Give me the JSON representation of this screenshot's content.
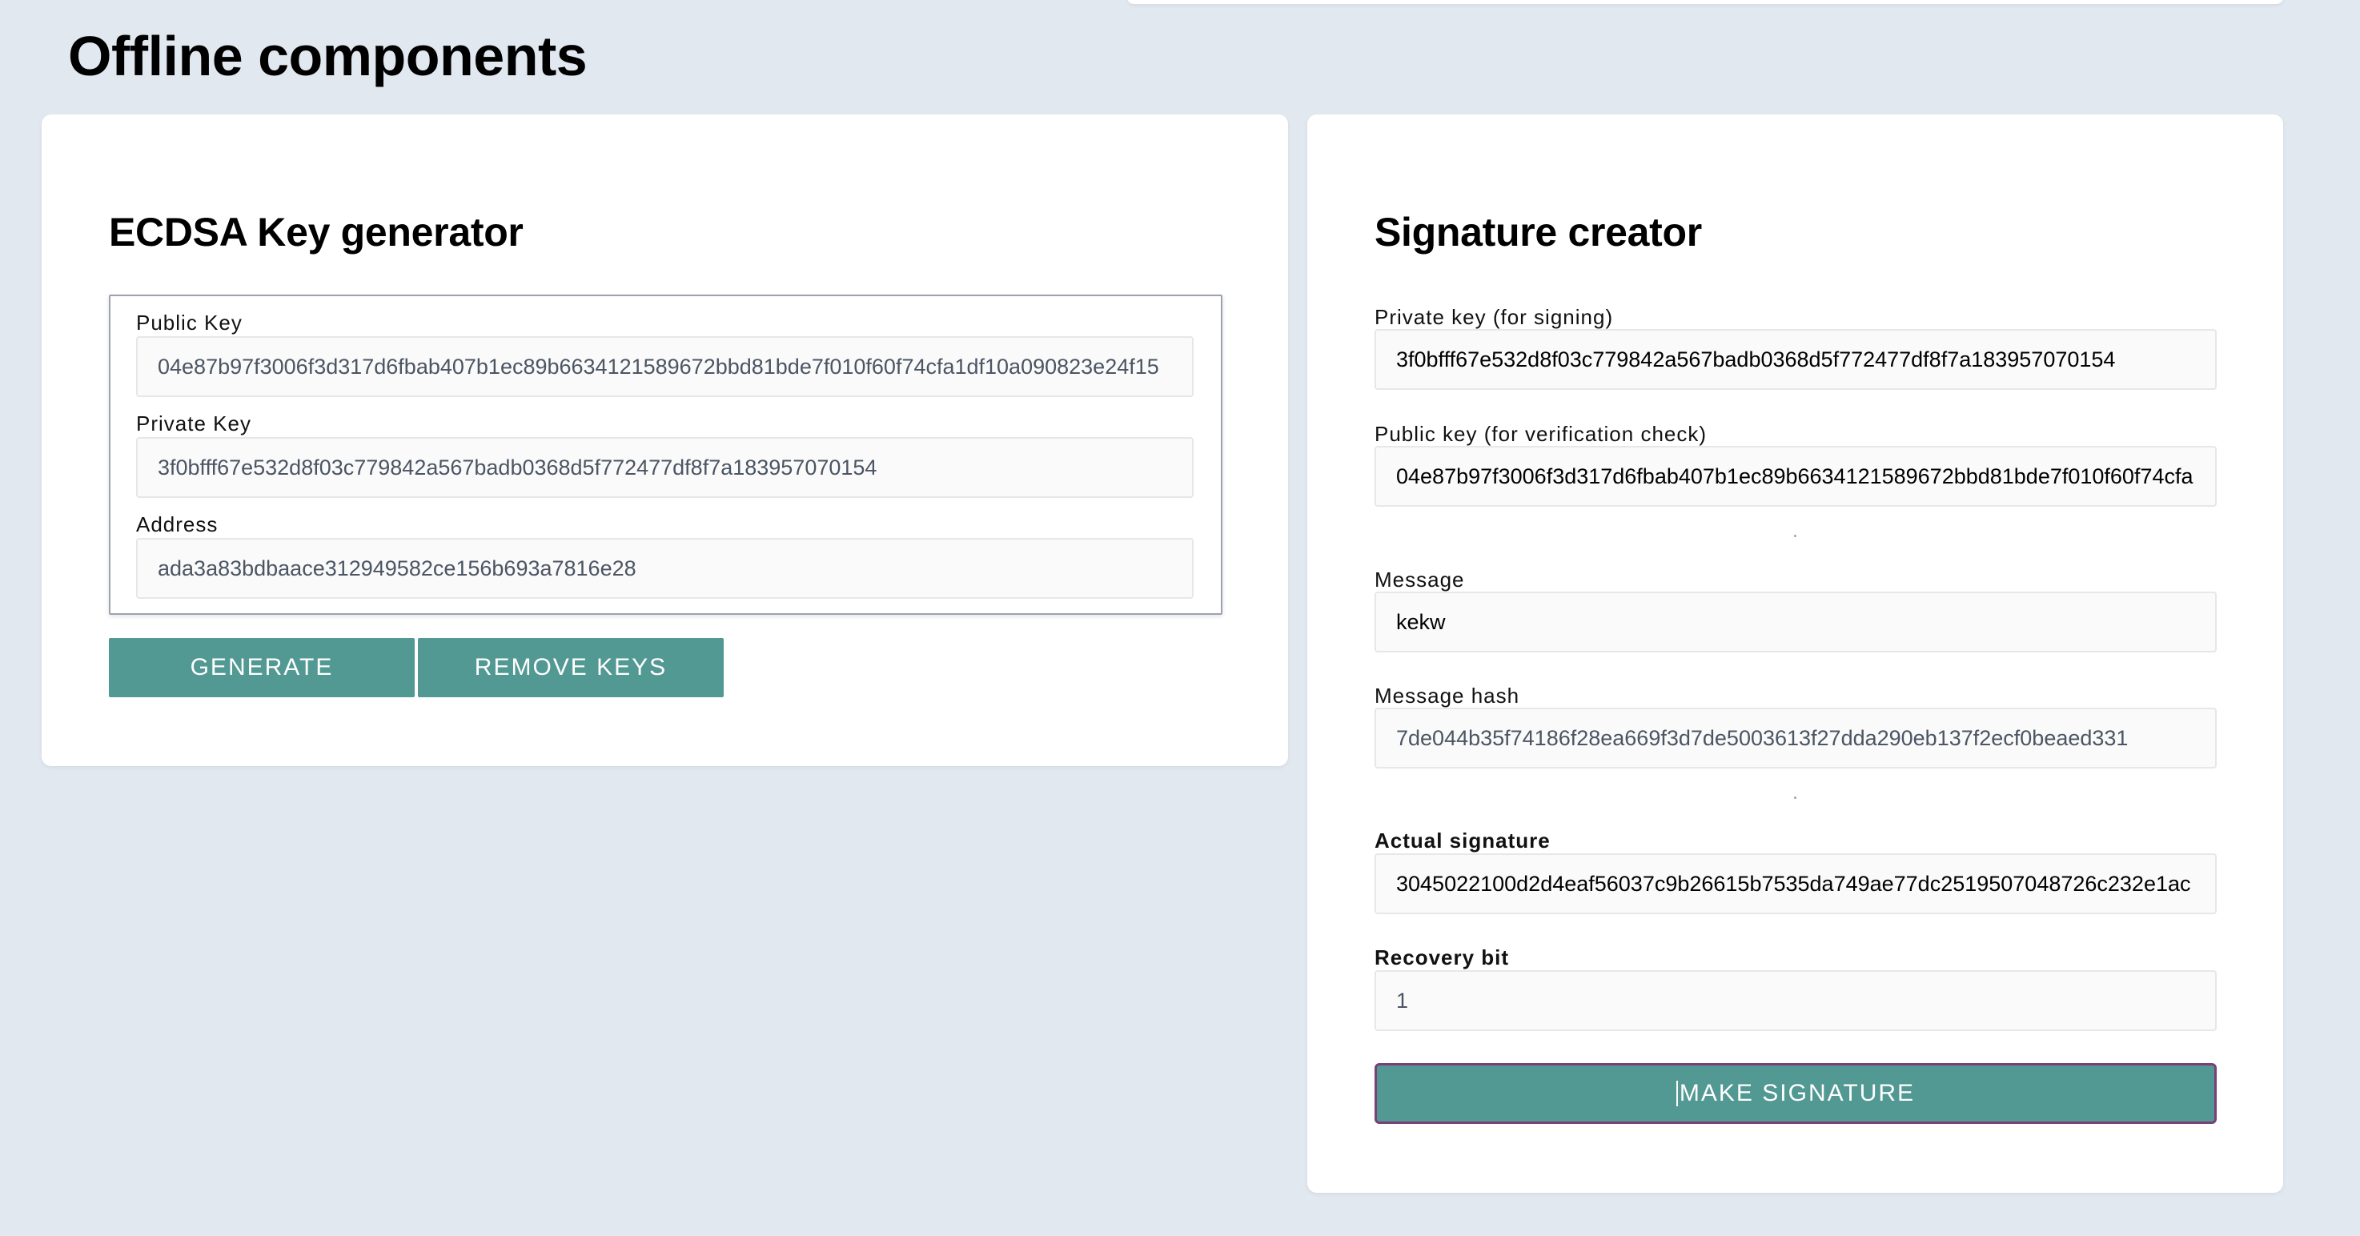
{
  "page": {
    "title": "Offline components"
  },
  "key_generator": {
    "title": "ECDSA Key generator",
    "public_key_label": "Public Key",
    "public_key_value": "04e87b97f3006f3d317d6fbab407b1ec89b6634121589672bbd81bde7f010f60f74cfa1df10a090823e24f15",
    "private_key_label": "Private Key",
    "private_key_value": "3f0bfff67e532d8f03c779842a567badb0368d5f772477df8f7a183957070154",
    "address_label": "Address",
    "address_value": "ada3a83bdbaace312949582ce156b693a7816e28",
    "generate_label": "GENERATE",
    "remove_label": "REMOVE KEYS"
  },
  "signature_creator": {
    "title": "Signature creator",
    "private_key_label": "Private key (for signing)",
    "private_key_value": "3f0bfff67e532d8f03c779842a567badb0368d5f772477df8f7a183957070154",
    "public_key_label": "Public key (for verification check)",
    "public_key_value": "04e87b97f3006f3d317d6fbab407b1ec89b6634121589672bbd81bde7f010f60f74cfa",
    "message_label": "Message",
    "message_value": "kekw",
    "hash_label": "Message hash",
    "hash_value": "7de044b35f74186f28ea669f3d7de5003613f27dda290eb137f2ecf0beaed331",
    "signature_label": "Actual signature",
    "signature_value": "3045022100d2d4eaf56037c9b26615b7535da749ae77dc2519507048726c232e1ac",
    "recovery_label": "Recovery bit",
    "recovery_value": "1",
    "make_label": "MAKE SIGNATURE"
  },
  "colors": {
    "background": "#e2e8f0",
    "card": "#ffffff",
    "button": "#529893",
    "button_focus_border": "#7b3f7a"
  }
}
